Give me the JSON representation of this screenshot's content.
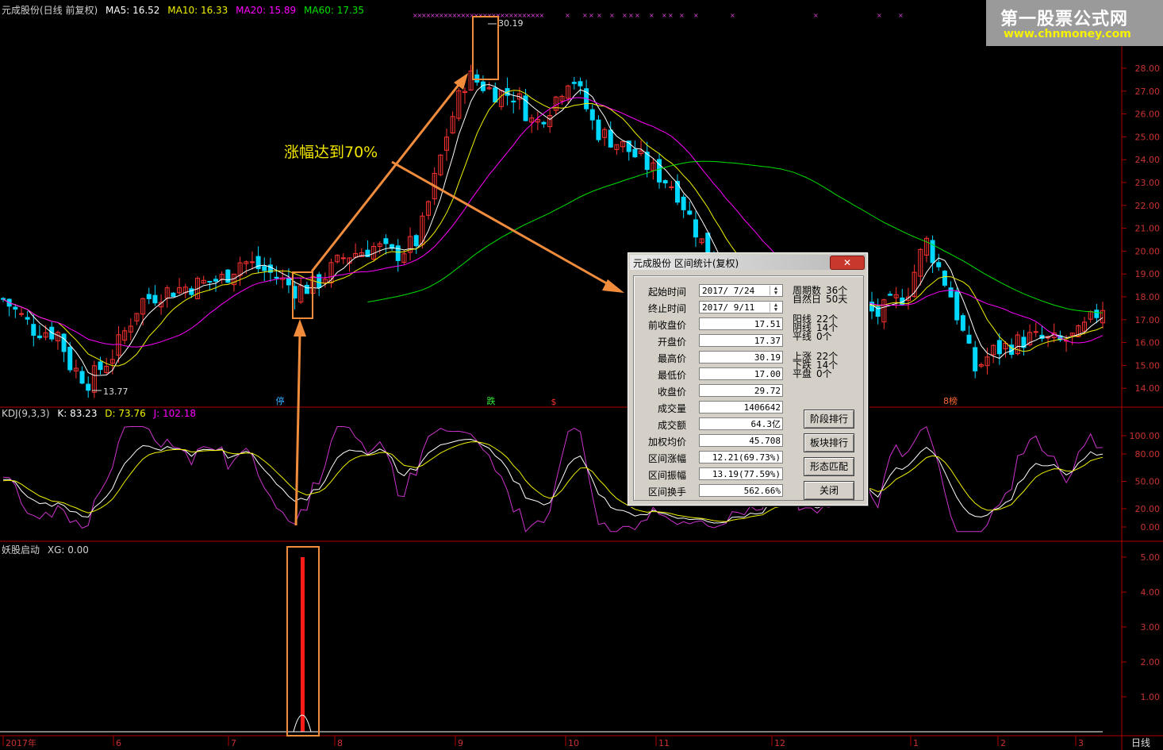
{
  "header": {
    "stock_title": "元成股份(日线 前复权)",
    "ma5": "MA5: 16.52",
    "ma10": "MA10: 16.33",
    "ma20": "MA20: 15.89",
    "ma60": "MA60: 17.35"
  },
  "kdj_header": {
    "name": "KDJ(9,3,3)",
    "k": "K: 83.23",
    "d": "D: 73.76",
    "j": "J: 102.18"
  },
  "indicator_header": {
    "name": "妖股启动",
    "xg": "XG: 0.00"
  },
  "logo": {
    "name": "第一股票公式网",
    "url": "www.chnmoney.com"
  },
  "annotation": "涨幅达到70%",
  "price_labels": {
    "high": "30.19",
    "low": "13.77"
  },
  "markers": {
    "ting": "停",
    "die": "跌",
    "dollar": "$",
    "bang": "8榜"
  },
  "x_axis": [
    "2017年",
    "6",
    "7",
    "8",
    "9",
    "10",
    "11",
    "12",
    "1",
    "2",
    "3"
  ],
  "period_label": "日线",
  "y_axis_price": [
    "28.00",
    "27.00",
    "26.00",
    "25.00",
    "24.00",
    "23.00",
    "22.00",
    "21.00",
    "20.00",
    "19.00",
    "18.00",
    "17.00",
    "16.00",
    "15.00",
    "14.00"
  ],
  "y_axis_kdj": [
    "100.00",
    "80.00",
    "50.00",
    "20.00",
    "0.00"
  ],
  "y_axis_ind": [
    "5.00",
    "4.00",
    "3.00",
    "2.00",
    "1.00"
  ],
  "colors": {
    "up": "#ff3232",
    "down": "#00d8ff",
    "ma5": "#ffffff",
    "ma10": "#f0f000",
    "ma20": "#ff00ff",
    "ma60": "#00e000",
    "highlight": "#f08c3c",
    "axis": "#b00000"
  },
  "dialog": {
    "title": "元成股份 区间统计(复权)",
    "close_btn": "✕",
    "fields": [
      {
        "label": "起始时间",
        "value": "2017/ 7/24"
      },
      {
        "label": "终止时间",
        "value": "2017/ 9/11"
      },
      {
        "label": "前收盘价",
        "value": "17.51"
      },
      {
        "label": "开盘价",
        "value": "17.37"
      },
      {
        "label": "最高价",
        "value": "30.19"
      },
      {
        "label": "最低价",
        "value": "17.00"
      },
      {
        "label": "收盘价",
        "value": "29.72"
      },
      {
        "label": "成交量",
        "value": "1406642"
      },
      {
        "label": "成交额",
        "value": "64.3亿"
      },
      {
        "label": "加权均价",
        "value": "45.708"
      },
      {
        "label": "区间涨幅",
        "value": "12.21(69.73%)"
      },
      {
        "label": "区间振幅",
        "value": "13.19(77.59%)"
      },
      {
        "label": "区间换手",
        "value": "562.66%"
      }
    ],
    "stats": [
      {
        "label": "周期数",
        "value": "36个"
      },
      {
        "label": "自然日",
        "value": "50天"
      },
      {
        "label": "阳线",
        "value": "22个"
      },
      {
        "label": "阴线",
        "value": "14个"
      },
      {
        "label": "平线",
        "value": "0个"
      },
      {
        "label": "上涨",
        "value": "22个"
      },
      {
        "label": "下跌",
        "value": "14个"
      },
      {
        "label": "平盘",
        "value": "0个"
      }
    ],
    "buttons": [
      "阶段排行",
      "板块排行",
      "形态匹配",
      "关闭"
    ]
  }
}
